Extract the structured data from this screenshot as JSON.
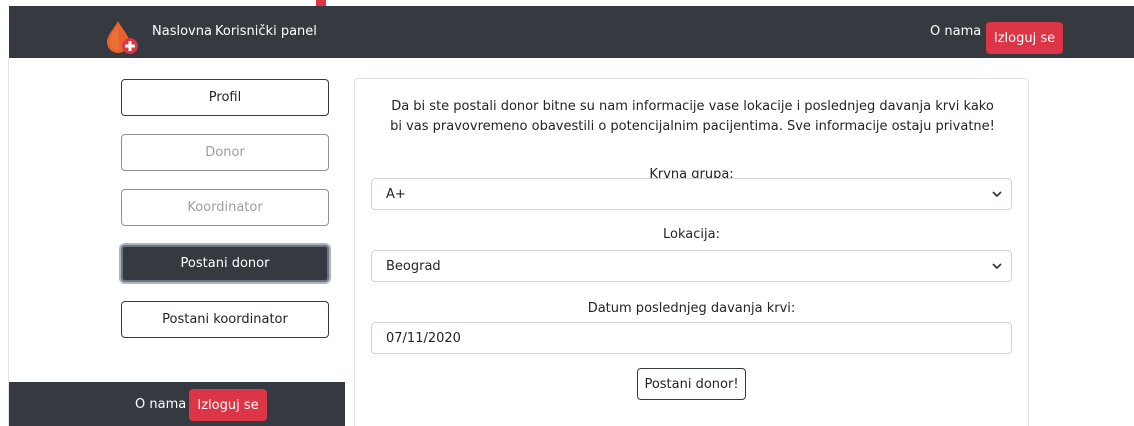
{
  "navbar": {
    "home_label": "Naslovna",
    "panel_label": "Korisnički panel",
    "about_label": "O nama",
    "logout_label": "Izloguj se"
  },
  "sidebar": {
    "items": [
      {
        "label": "Profil"
      },
      {
        "label": "Donor"
      },
      {
        "label": "Koordinator"
      },
      {
        "label": "Postani donor"
      },
      {
        "label": "Postani koordinator"
      }
    ]
  },
  "footer": {
    "about_label": "O nama",
    "logout_label": "Izloguj se"
  },
  "form": {
    "intro": "Da bi ste postali donor bitne su nam informacije vase lokacije i poslednjeg davanja krvi kako bi vas pravovremeno obavestili o potencijalnim pacijentima. Sve informacije ostaju privatne!",
    "blood_group_label": "Krvna grupa:",
    "blood_group_value": "A+",
    "location_label": "Lokacija:",
    "location_value": "Beograd",
    "date_label": "Datum poslednjeg davanja krvi:",
    "date_value": "07/11/2020",
    "submit_label": "Postani donor!"
  },
  "colors": {
    "navbar_bg": "#343a40",
    "danger": "#dc3545"
  }
}
